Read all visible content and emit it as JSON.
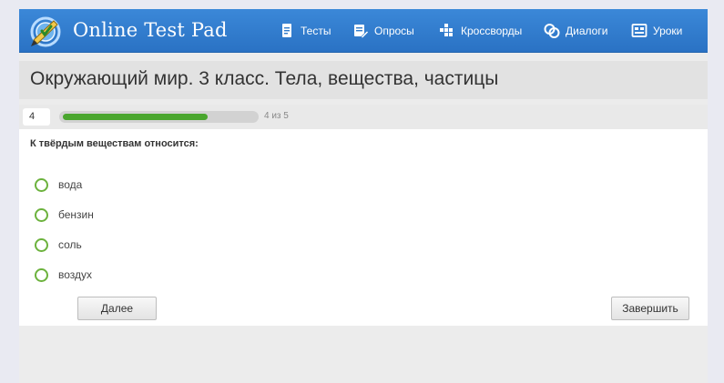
{
  "header": {
    "brand": "Online Test Pad",
    "nav": [
      {
        "label": "Тесты",
        "icon": "document-icon"
      },
      {
        "label": "Опросы",
        "icon": "poll-edit-icon"
      },
      {
        "label": "Кроссворды",
        "icon": "crossword-grid-icon"
      },
      {
        "label": "Диалоги",
        "icon": "chat-bubbles-icon"
      },
      {
        "label": "Уроки",
        "icon": "lessons-board-icon"
      }
    ]
  },
  "test": {
    "title": "Окружающий мир. 3 класс. Тела, вещества, частицы",
    "question_number": "4",
    "progress_text": "4 из 5",
    "progress_fraction": 0.8,
    "question": "К твёрдым веществам относится:",
    "options": [
      "вода",
      "бензин",
      "соль",
      "воздух"
    ]
  },
  "buttons": {
    "next": "Далее",
    "finish": "Завершить"
  },
  "colors": {
    "header": "#2f7acb",
    "progress_fill": "#4aa62e",
    "radio_border": "#6cb23d"
  }
}
